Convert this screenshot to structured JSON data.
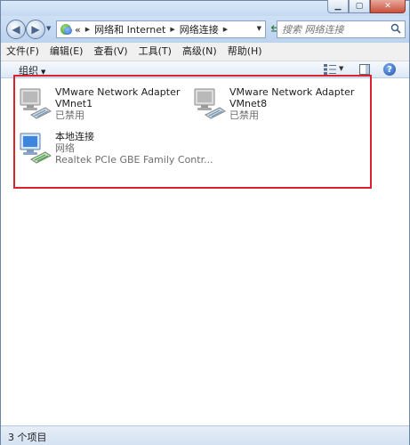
{
  "window": {
    "controls": [
      "minimize",
      "maximize",
      "close"
    ]
  },
  "address": {
    "overflow": "«",
    "breadcrumbs": [
      "网络和 Internet",
      "网络连接"
    ]
  },
  "search": {
    "placeholder": "搜索 网络连接"
  },
  "menu": {
    "items": [
      "文件(F)",
      "编辑(E)",
      "查看(V)",
      "工具(T)",
      "高级(N)",
      "帮助(H)"
    ]
  },
  "toolbar": {
    "organize": "组织"
  },
  "connections": [
    {
      "name": "VMware Network Adapter",
      "name2": "VMnet1",
      "status": "已禁用",
      "device": "",
      "icon": "disabled-network-adapter-icon"
    },
    {
      "name": "VMware Network Adapter",
      "name2": "VMnet8",
      "status": "已禁用",
      "device": "",
      "icon": "disabled-network-adapter-icon"
    },
    {
      "name": "本地连接",
      "name2": "",
      "status": "网络",
      "device": "Realtek PCIe GBE Family Contr...",
      "icon": "network-adapter-icon"
    }
  ],
  "statusbar": {
    "count": "3 个项目"
  },
  "colors": {
    "highlight_border": "#d9242d",
    "window_frame": "#c9dcf2"
  }
}
